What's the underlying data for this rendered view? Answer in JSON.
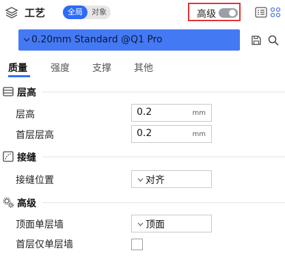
{
  "header": {
    "title": "工艺",
    "mode_global": "全局",
    "mode_object": "对象",
    "advanced_label": "高级",
    "advanced_enabled": false
  },
  "preset": {
    "value": "0.20mm Standard @Q1 Pro"
  },
  "tabs": [
    {
      "label": "质量",
      "active": true
    },
    {
      "label": "强度",
      "active": false
    },
    {
      "label": "支撑",
      "active": false
    },
    {
      "label": "其他",
      "active": false
    }
  ],
  "sections": {
    "layer_height": {
      "title": "层高",
      "rows": [
        {
          "label": "层高",
          "value": "0.2",
          "unit": "mm"
        },
        {
          "label": "首层层高",
          "value": "0.2",
          "unit": "mm"
        }
      ]
    },
    "seam": {
      "title": "接缝",
      "rows": [
        {
          "label": "接缝位置",
          "value": "对齐"
        }
      ]
    },
    "advanced": {
      "title": "高级",
      "rows": [
        {
          "label": "顶面单层墙",
          "value": "顶面"
        },
        {
          "label": "首层仅单层墙",
          "checked": false
        }
      ]
    }
  },
  "colors": {
    "accent": "#2e6cf6",
    "preset_bg": "#4479f4",
    "highlight_border": "#e0322f"
  }
}
